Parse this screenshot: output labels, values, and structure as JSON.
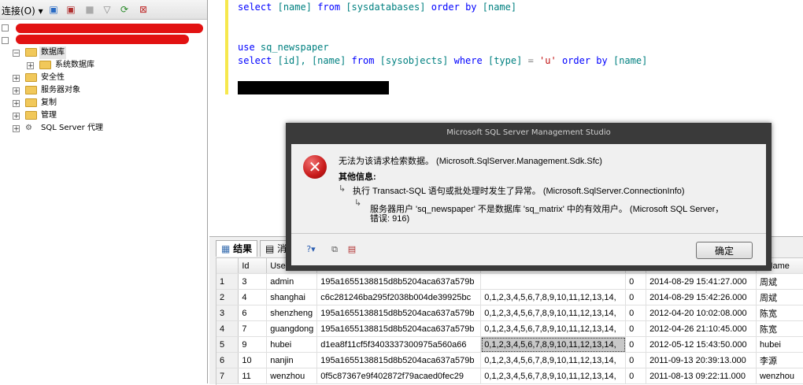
{
  "explorer": {
    "connect_label": "连接(O) ▾",
    "tree": [
      {
        "label": "数据库"
      },
      {
        "label": "系统数据库"
      },
      {
        "label": "安全性"
      },
      {
        "label": "服务器对象"
      },
      {
        "label": "复制"
      },
      {
        "label": "管理"
      },
      {
        "label": "SQL Server 代理"
      }
    ]
  },
  "editor": {
    "lines": [
      {
        "k1": "select",
        "a": "[name]",
        "k2": "from",
        "b": "[sysdatabases]",
        "k3": "order by",
        "c": "[name]"
      },
      {
        "k1": "use",
        "a": "sq_newspaper"
      },
      {
        "k1": "select",
        "a": "[id], [name]",
        "k2": "from",
        "b": "[sysobjects]",
        "k3": "where",
        "c": "[type]",
        "op": "=",
        "s": "'u'",
        "k4": "order by",
        "d": "[name]"
      }
    ]
  },
  "results": {
    "tab_results": "结果",
    "tab_messages": "消",
    "columns": [
      "",
      "Id",
      "User",
      "",
      "",
      "",
      "",
      "alName"
    ],
    "rows": [
      [
        "1",
        "3",
        "admin",
        "195a1655138815d8b5204aca637a579b",
        "",
        "0",
        "2014-08-29 15:41:27.000",
        "周斌"
      ],
      [
        "2",
        "4",
        "shanghai",
        "c6c281246ba295f2038b004de39925bc",
        "0,1,2,3,4,5,6,7,8,9,10,11,12,13,14,",
        "0",
        "2014-08-29 15:42:26.000",
        "周斌"
      ],
      [
        "3",
        "6",
        "shenzheng",
        "195a1655138815d8b5204aca637a579b",
        "0,1,2,3,4,5,6,7,8,9,10,11,12,13,14,",
        "0",
        "2012-04-20 10:02:08.000",
        "陈宽"
      ],
      [
        "4",
        "7",
        "guangdong",
        "195a1655138815d8b5204aca637a579b",
        "0,1,2,3,4,5,6,7,8,9,10,11,12,13,14,",
        "0",
        "2012-04-26 21:10:45.000",
        "陈宽"
      ],
      [
        "5",
        "9",
        "hubei",
        "d1ea8f11cf5f3403337300975a560a66",
        "0,1,2,3,4,5,6,7,8,9,10,11,12,13,14,",
        "0",
        "2012-05-12 15:43:50.000",
        "hubei"
      ],
      [
        "6",
        "10",
        "nanjin",
        "195a1655138815d8b5204aca637a579b",
        "0,1,2,3,4,5,6,7,8,9,10,11,12,13,14,",
        "0",
        "2011-09-13 20:39:13.000",
        "李源"
      ],
      [
        "7",
        "11",
        "wenzhou",
        "0f5c87367e9f402872f79acaed0fec29",
        "0,1,2,3,4,5,6,7,8,9,10,11,12,13,14,",
        "0",
        "2011-08-13 09:22:11.000",
        "wenzhou"
      ]
    ]
  },
  "dialog": {
    "title": "Microsoft SQL Server Management Studio",
    "message": "无法为该请求检索数据。 (Microsoft.SqlServer.Management.Sdk.Sfc)",
    "more_info": "其他信息:",
    "detail1": "执行 Transact-SQL 语句或批处理时发生了异常。 (Microsoft.SqlServer.ConnectionInfo)",
    "detail2_line1": "服务器用户 'sq_newspaper' 不是数据库 'sq_matrix' 中的有效用户。 (Microsoft SQL Server，",
    "detail2_line2": "错误: 916)",
    "ok_label": "确定"
  },
  "colors": {
    "accent_error": "#c81a1a",
    "keyword": "#0000ff",
    "identifier": "#008080",
    "string": "#c01010"
  }
}
